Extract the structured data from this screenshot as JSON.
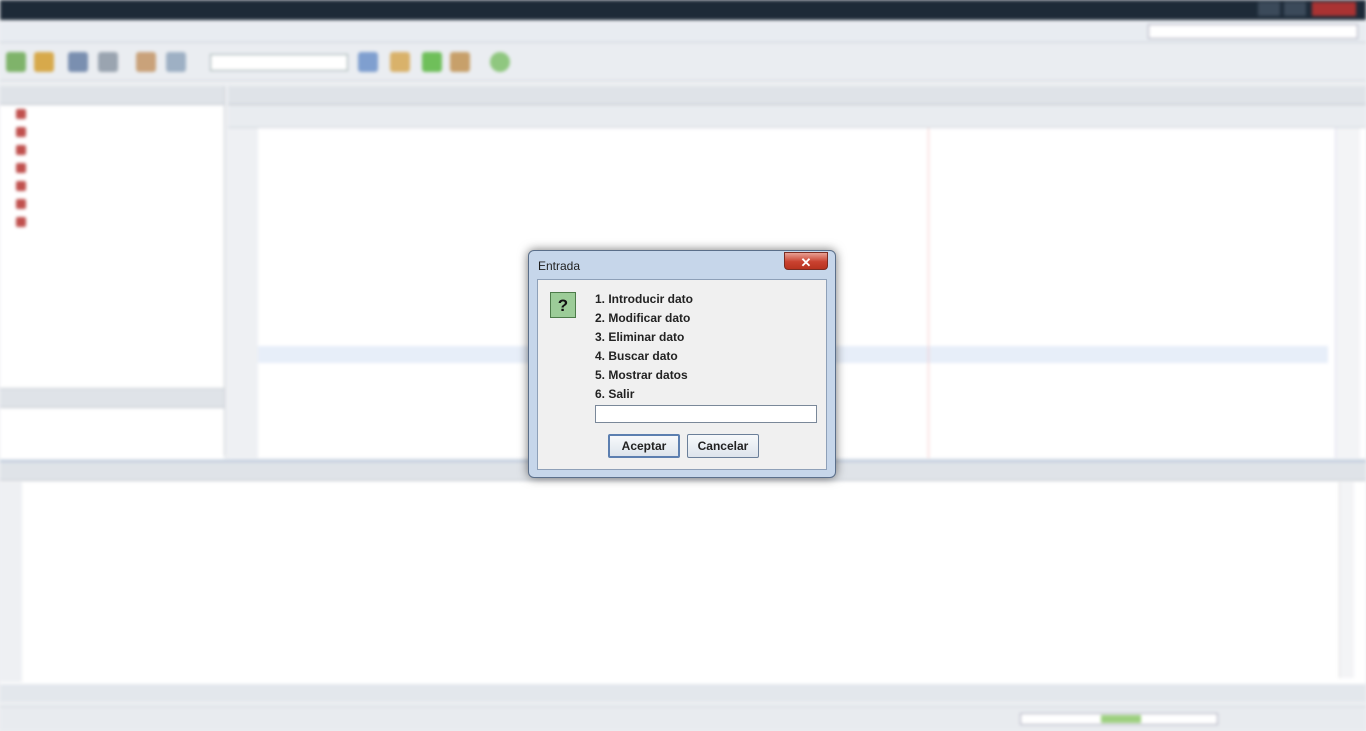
{
  "dialog": {
    "title": "Entrada",
    "close_glyph": "✕",
    "icon": "question-icon",
    "icon_glyph": "?",
    "options": [
      "1.  Introducir dato",
      "2.  Modificar dato",
      "3.  Eliminar dato",
      "4.  Buscar dato",
      "5.  Mostrar datos",
      "6.  Salir"
    ],
    "input_value": "",
    "ok_label": "Aceptar",
    "cancel_label": "Cancelar"
  }
}
